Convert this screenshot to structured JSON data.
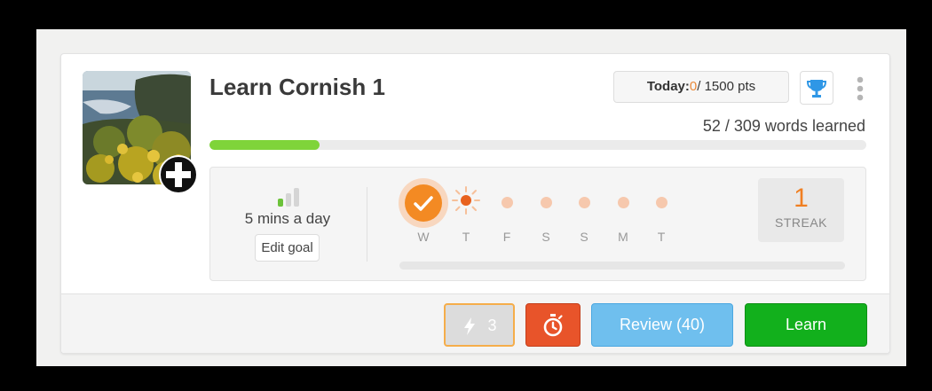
{
  "course": {
    "title": "Learn Cornish 1",
    "today_label": "Today:",
    "today_points": "0",
    "today_total": "/ 1500 pts",
    "words_learned": "52 / 309 words learned",
    "progress": 0.168
  },
  "goal": {
    "text": "5 mins a day",
    "edit_label": "Edit goal"
  },
  "week": {
    "days": [
      "W",
      "T",
      "F",
      "S",
      "S",
      "M",
      "T"
    ],
    "completed_days": 1
  },
  "streak": {
    "count": "1",
    "label": "STREAK"
  },
  "actions": {
    "boost_count": "3",
    "review_label": "Review (40)",
    "learn_label": "Learn"
  },
  "colors": {
    "accent_orange": "#f38a23",
    "progress_green": "#7fd43a",
    "review_blue": "#6fbfee",
    "learn_green": "#12b01c",
    "timer_red": "#e8542a",
    "trophy_blue": "#2f97e6"
  },
  "icons": {
    "trophy": "trophy-icon",
    "kebab": "kebab-menu-icon",
    "signal": "signal-bars-icon",
    "check": "check-icon",
    "sun": "sun-icon",
    "bolt": "lightning-bolt-icon",
    "timer": "stopwatch-icon",
    "add": "plus-icon"
  }
}
